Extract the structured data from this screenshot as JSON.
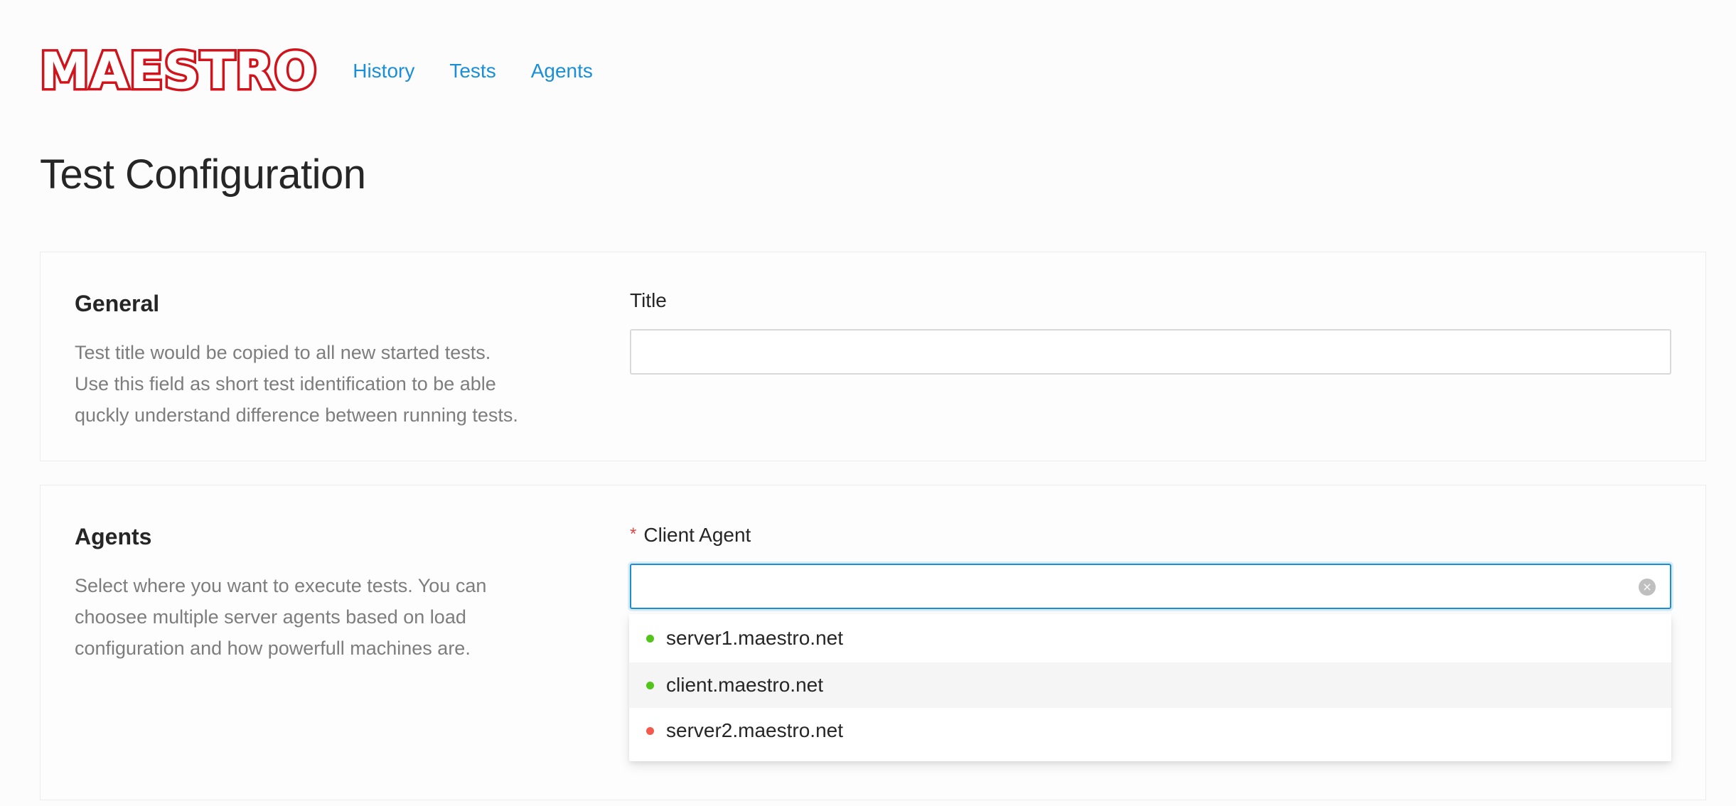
{
  "app": {
    "logo_text": "MAESTRO"
  },
  "nav": {
    "items": [
      {
        "label": "History"
      },
      {
        "label": "Tests"
      },
      {
        "label": "Agents"
      }
    ]
  },
  "page": {
    "title": "Test Configuration"
  },
  "general": {
    "title": "General",
    "description_lines": [
      "Test title would be copied to all new started tests.",
      "Use this field as short test identification to be able",
      "quckly understand difference between running tests."
    ],
    "field_label": "Title",
    "field_value": ""
  },
  "agents": {
    "title": "Agents",
    "description_lines": [
      "Select where you want to execute tests. You can",
      "choosee multiple server agents based on load",
      "configuration and how powerfull machines are."
    ],
    "required_mark": "*",
    "field_label": "Client Agent",
    "field_value": "",
    "clear_icon": "×",
    "options": [
      {
        "label": "server1.maestro.net",
        "status": "online",
        "color": "#52c41a"
      },
      {
        "label": "client.maestro.net",
        "status": "online",
        "color": "#52c41a",
        "hovered": true
      },
      {
        "label": "server2.maestro.net",
        "status": "offline",
        "color": "#f5584d"
      }
    ]
  },
  "colors": {
    "brand": "#d1141b",
    "link": "#1a8fd8",
    "online": "#52c41a",
    "offline": "#f5584d"
  }
}
